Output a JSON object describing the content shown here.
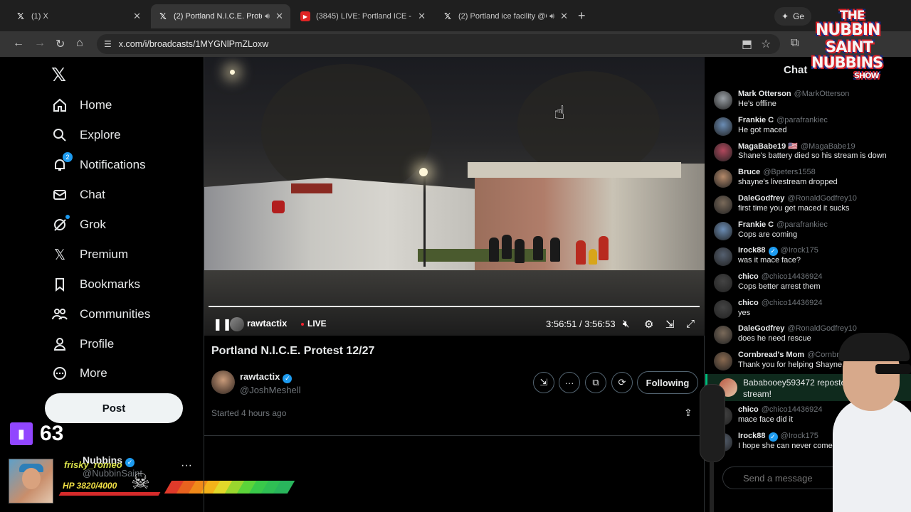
{
  "browser": {
    "tabs": [
      {
        "title": "(1) X",
        "favicon": "x-icon",
        "muted": false
      },
      {
        "title": "(2) Portland N.I.C.E. Protest",
        "favicon": "x-icon",
        "muted": true
      },
      {
        "title": "(3845) LIVE: Portland ICE - Dece",
        "favicon": "youtube-icon",
        "muted": false
      },
      {
        "title": "(2) Portland ice facility @Ch",
        "favicon": "x-icon",
        "muted": true
      }
    ],
    "gemini_label": "Ge",
    "url": "x.com/i/broadcasts/1MYGNlPmZLoxw"
  },
  "sidebar": {
    "logo": "𝕏",
    "items": [
      {
        "label": "Home",
        "icon": "home-icon"
      },
      {
        "label": "Explore",
        "icon": "search-icon"
      },
      {
        "label": "Notifications",
        "icon": "bell-icon",
        "badge": "2"
      },
      {
        "label": "Chat",
        "icon": "mail-icon"
      },
      {
        "label": "Grok",
        "icon": "grok-icon"
      },
      {
        "label": "Premium",
        "icon": "x-icon"
      },
      {
        "label": "Bookmarks",
        "icon": "bookmark-icon"
      },
      {
        "label": "Communities",
        "icon": "people-icon"
      },
      {
        "label": "Profile",
        "icon": "person-icon"
      },
      {
        "label": "More",
        "icon": "more-circle-icon"
      }
    ],
    "post_label": "Post",
    "account_name": "Nubbins",
    "account_handle": "@NubbinSaint"
  },
  "overlay": {
    "viewer_count": "63",
    "streamer_name": "frisky_romeo",
    "hp_text": "HP 3820/4000",
    "hp_fraction": 0.955,
    "show_logo_lines": [
      "THE",
      "NUBBIN",
      "SAINT",
      "NUBBINS",
      "SHOW"
    ]
  },
  "broadcast": {
    "player_user": "rawtactix",
    "live_label": "LIVE",
    "time": "3:56:51 / 3:56:53",
    "progress_fraction": 0.999,
    "title": "Portland N.I.C.E. Protest 12/27",
    "host_name": "rawtactix",
    "host_handle": "@JoshMeshell",
    "follow_label": "Following",
    "started": "Started 4 hours ago"
  },
  "chat": {
    "title": "Chat",
    "messages": [
      {
        "name": "Mark Otterson",
        "handle": "@MarkOtterson",
        "text": "He's offline",
        "color": "#9aa0a6"
      },
      {
        "name": "Frankie C",
        "handle": "@parafrankiec",
        "text": "He got maced",
        "color": "#6b8db5"
      },
      {
        "name": "MagaBabe19 🇺🇸",
        "handle": "@MagaBabe19",
        "text": "Shane's battery died so his stream is down",
        "color": "#b2485d"
      },
      {
        "name": "Bruce",
        "handle": "@Bpeters1558",
        "text": "shayne's livestream dropped",
        "color": "#b58a6a"
      },
      {
        "name": "DaleGodfrey",
        "handle": "@RonaldGodfrey10",
        "text": "first time you get maced it sucks",
        "color": "#7a6a5a"
      },
      {
        "name": "Frankie C",
        "handle": "@parafrankiec",
        "text": "Cops are coming",
        "color": "#6b8db5"
      },
      {
        "name": "Irock88",
        "handle": "@Irock175",
        "text": "was it mace face?",
        "color": "#556070",
        "verified": true
      },
      {
        "name": "chico",
        "handle": "@chico14436924",
        "text": "Cops better arrest them",
        "color": "#444444"
      },
      {
        "name": "chico",
        "handle": "@chico14436924",
        "text": "yes",
        "color": "#444444"
      },
      {
        "name": "DaleGodfrey",
        "handle": "@RonaldGodfrey10",
        "text": "does he need rescue",
        "color": "#7a6a5a"
      },
      {
        "name": "Cornbread's Mom",
        "handle": "@Cornbreadsr",
        "text": "Thank you for helping Shayne.",
        "color": "#8a6a50"
      }
    ],
    "repost_text": "Bababooey593472 reposted the stream!",
    "messages_after": [
      {
        "name": "chico",
        "handle": "@chico14436924",
        "text": "mace face did it",
        "color": "#444444"
      },
      {
        "name": "Irock88",
        "handle": "@Irock175",
        "text": "I hope she can never come back",
        "color": "#556070",
        "verified": true
      }
    ],
    "send_placeholder": "Send a message"
  }
}
